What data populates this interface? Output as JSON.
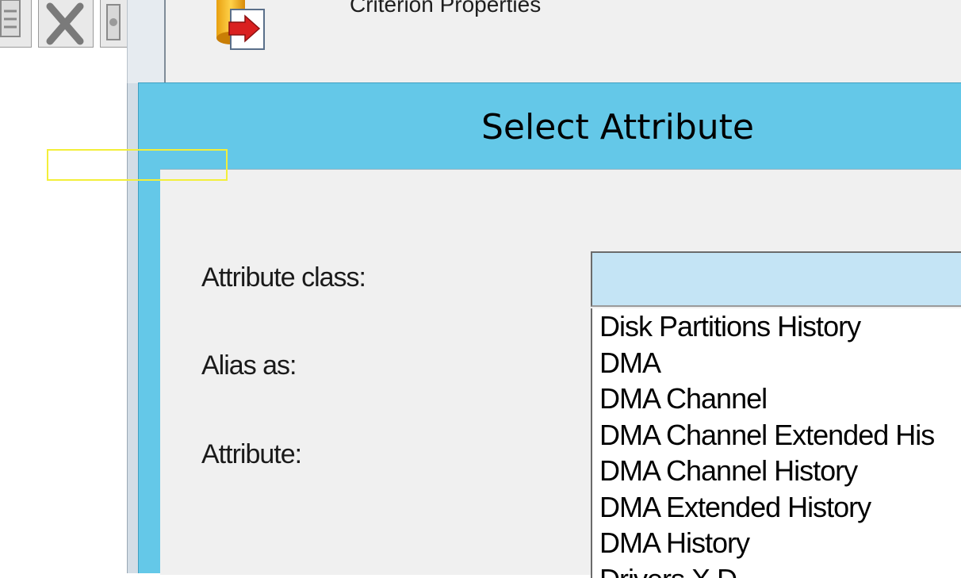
{
  "background_window": {
    "title": "Criterion Properties",
    "icon": "database-arrow-icon"
  },
  "toolbar": {
    "icons": [
      "document-icon",
      "delete-icon",
      "tool-icon"
    ]
  },
  "dialog": {
    "title": "Select Attribute",
    "labels": {
      "attribute_class": "Attribute class:",
      "alias_as": "Alias as:",
      "attribute": "Attribute:"
    },
    "attribute_class_value": "",
    "attribute_class_options": [
      "Disk Partitions History",
      "DMA",
      "DMA Channel",
      "DMA Channel Extended His",
      "DMA Channel History",
      "DMA Extended History",
      "DMA History",
      "Drivers X D"
    ]
  },
  "colors": {
    "dialog_accent": "#64c8e8",
    "combo_selected": "#c4e4f5",
    "highlight": "#f3ef3a"
  }
}
